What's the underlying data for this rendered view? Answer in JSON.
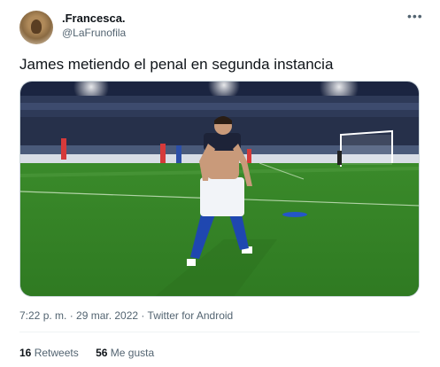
{
  "header": {
    "display_name": ".Francesca.",
    "handle": "@LaFrunofila",
    "more_label": "•••"
  },
  "tweet": {
    "text": "James metiendo el penal en segunda instancia",
    "timestamp": "7:22 p. m. · 29 mar. 2022 · Twitter for Android"
  },
  "stats": {
    "retweets_count": "16",
    "retweets_label": "Retweets",
    "likes_count": "56",
    "likes_label": "Me gusta"
  },
  "colors": {
    "text": "#0f1419",
    "secondary": "#536471",
    "border": "#cfd9de",
    "pitch": "#3f8f2e"
  },
  "icons": {
    "more": "more-dots-icon"
  }
}
